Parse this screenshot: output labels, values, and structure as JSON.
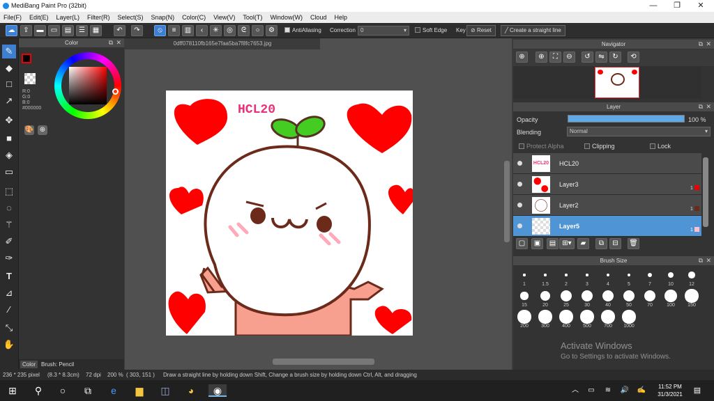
{
  "window": {
    "title": "MediBang Paint Pro (32bit)",
    "minimize": "—",
    "maximize": "❐",
    "close": "✕"
  },
  "menu": [
    "File(F)",
    "Edit(E)",
    "Layer(L)",
    "Filter(R)",
    "Select(S)",
    "Snap(N)",
    "Color(C)",
    "View(V)",
    "Tool(T)",
    "Window(W)",
    "Cloud",
    "Help"
  ],
  "toolbar": {
    "antialiasing_label": "AntiAliasing",
    "correction_label": "Correction",
    "correction_value": "0",
    "soft_edge_label": "Soft Edge",
    "key_label": "Key",
    "reset_label": "Reset",
    "straight_line_label": "Create a straight line"
  },
  "color_panel": {
    "title": "Color",
    "r": "R:0",
    "g": "G:0",
    "b": "B:0",
    "hex": "#000000",
    "tab_color": "Color",
    "tab_brush": "Brush: Pencil"
  },
  "document": {
    "tab_name": "0dff078110fb165e7faa5ba7f8fc7653.jpg",
    "canvas_text": "HCL20"
  },
  "navigator": {
    "title": "Navigator"
  },
  "layer_panel": {
    "title": "Layer",
    "opacity_label": "Opacity",
    "opacity_value": "100 %",
    "blending_label": "Blending",
    "blending_value": "Normal",
    "protect_alpha": "Protect Alpha",
    "clipping": "Clipping",
    "lock": "Lock",
    "layers": [
      {
        "name": "HCL20",
        "thumb_text": "HCL20"
      },
      {
        "name": "Layer3",
        "num": "1"
      },
      {
        "name": "Layer2",
        "num": "1"
      },
      {
        "name": "Layer5",
        "num": "1"
      }
    ]
  },
  "brush_size": {
    "title": "Brush Size",
    "sizes": [
      "1",
      "1.5",
      "2",
      "3",
      "4",
      "5",
      "7",
      "10",
      "12",
      "15",
      "20",
      "25",
      "30",
      "40",
      "50",
      "70",
      "100",
      "150",
      "200",
      "300",
      "400",
      "500",
      "700",
      "1000"
    ]
  },
  "status": {
    "size": "236 * 235 pixel",
    "cm": "(8.3 * 8.3cm)",
    "dpi": "72 dpi",
    "zoom": "200 %",
    "coords": "( 303, 151 )",
    "hint": "Draw a straight line by holding down Shift, Change a brush size by holding down Ctrl, Alt, and dragging"
  },
  "watermark": {
    "line1": "Activate Windows",
    "line2": "Go to Settings to activate Windows."
  },
  "taskbar": {
    "time": "11:52 PM",
    "date": "31/3/2021"
  },
  "colors": {
    "accent": "#3d7fd0",
    "layer_selected": "#4f95d6",
    "heart": "#ff0000",
    "canvas_text": "#e8317a"
  }
}
